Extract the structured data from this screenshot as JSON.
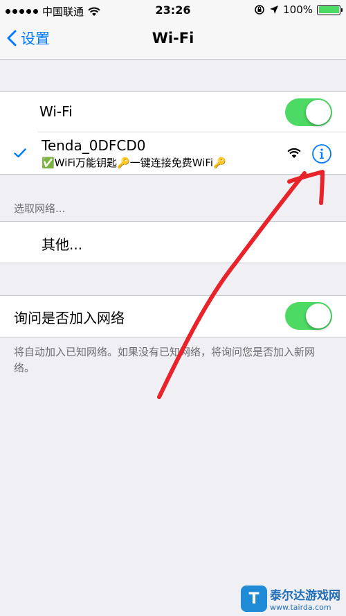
{
  "status_bar": {
    "carrier": "中国联通",
    "time": "23:26",
    "battery_percent": "100%",
    "battery_level": 1.0,
    "icons": [
      "signal-dots",
      "wifi-icon",
      "orientation-lock-icon",
      "location-icon",
      "battery-icon"
    ]
  },
  "nav": {
    "back_label": "设置",
    "title": "Wi-Fi"
  },
  "wifi_group": {
    "toggle_label": "Wi-Fi",
    "toggle_on": true,
    "connected_network": {
      "name": "Tenda_0DFCD0",
      "subtitle": "✅WiFi万能钥匙🔑一键连接免费WiFi🔑",
      "checked": true
    }
  },
  "choose_network": {
    "header": "选取网络...",
    "other_label": "其他..."
  },
  "ask_join": {
    "label": "询问是否加入网络",
    "toggle_on": true,
    "footer": "将自动加入已知网络。如果没有已知网络，将询问您是否加入新网络。"
  },
  "colors": {
    "accent": "#007aff",
    "toggle_on": "#4cd964",
    "annotation": "#e8232a"
  },
  "watermark": {
    "logo_letter": "T",
    "name": "泰尔达游戏网",
    "url": "www.tairda.com"
  }
}
